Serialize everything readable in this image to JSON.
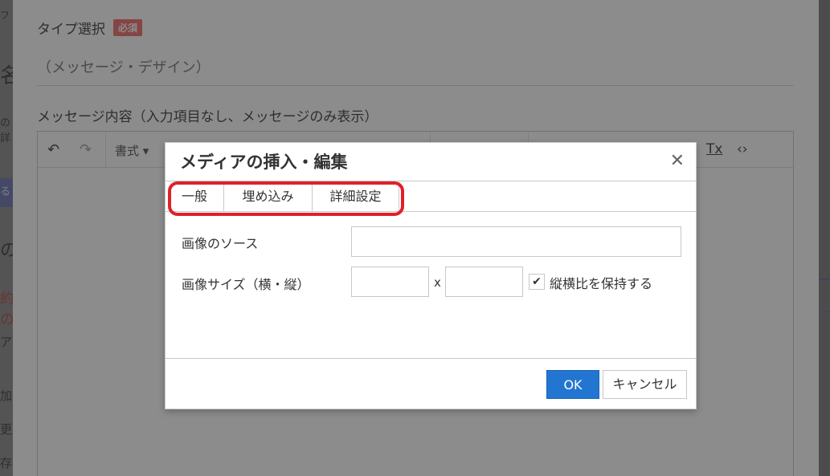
{
  "background": {
    "left_fragments": [
      "フ",
      "名",
      "の詳",
      "る",
      "の",
      "約の",
      "ア",
      "加",
      "更",
      "存"
    ],
    "type_field": {
      "label": "タイプ選択",
      "required_badge": "必須",
      "value": "（メッセージ・デザイン）"
    },
    "message_label": "メッセージ内容（入力項目なし、メッセージのみ表示）",
    "toolbar": {
      "format_label": "書式",
      "undo_icon": "↶",
      "redo_icon": "↷",
      "clear_format_icon": "Tx",
      "code_icon": "‹›"
    }
  },
  "dialog": {
    "title": "メディアの挿入・編集",
    "close_icon": "✕",
    "tabs": [
      {
        "label": "一般"
      },
      {
        "label": "埋め込み"
      },
      {
        "label": "詳細設定"
      }
    ],
    "fields": {
      "source_label": "画像のソース",
      "source_value": "",
      "size_label": "画像サイズ（横・縦）",
      "width_value": "",
      "height_value": "",
      "times_sign": "x",
      "keep_ratio_label": "縦横比を保持する",
      "keep_ratio_checked": true
    },
    "buttons": {
      "ok": "OK",
      "cancel": "キャンセル"
    }
  },
  "colors": {
    "primary": "#2276d2",
    "highlight": "#e0202a",
    "badge": "#f47c7c"
  }
}
